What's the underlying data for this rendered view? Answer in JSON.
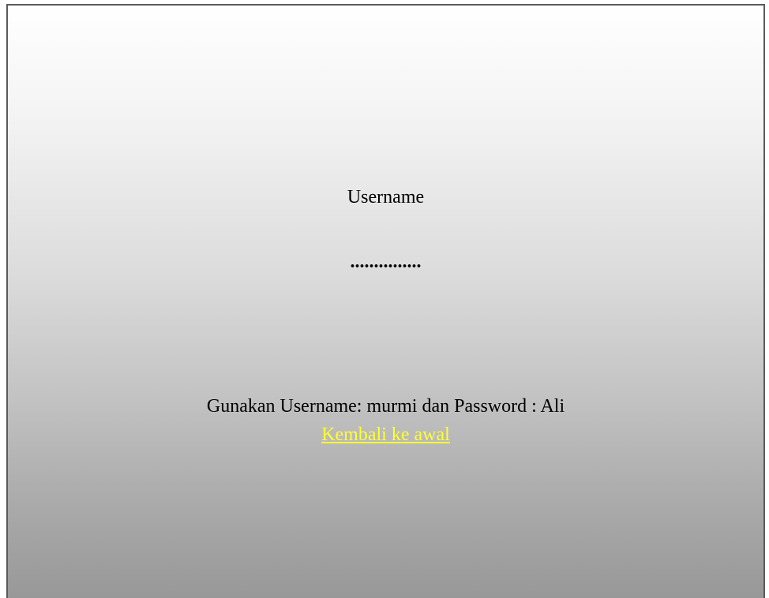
{
  "login": {
    "username_value": "Username",
    "password_value": "..............."
  },
  "hint": {
    "text": "Gunakan Username: murmi dan Password : Ali"
  },
  "back_link": {
    "label": "Kembali ke awal"
  },
  "colors": {
    "link": "#ffff33",
    "border": "#5a5a5a",
    "gradient_top": "#ffffff",
    "gradient_bottom": "#989898"
  }
}
